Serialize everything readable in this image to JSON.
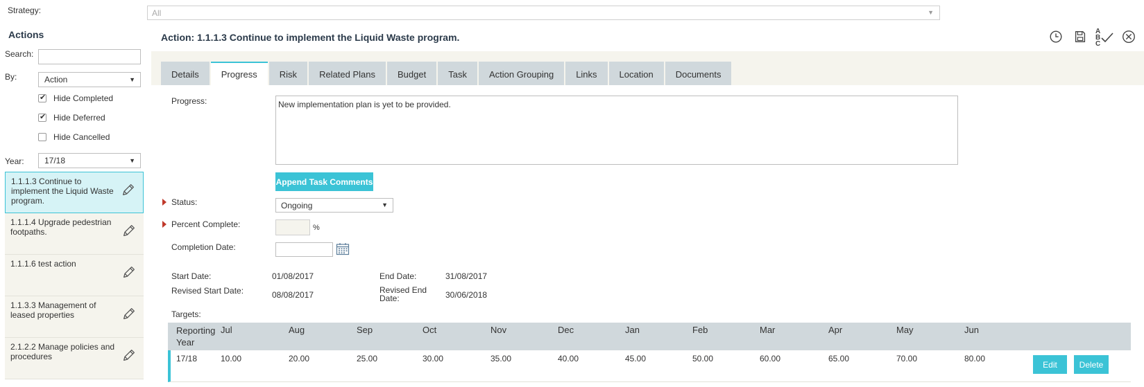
{
  "strategy": {
    "label": "Strategy:",
    "value": "All"
  },
  "sidebar": {
    "title": "Actions",
    "search_label": "Search:",
    "by_label": "By:",
    "by_value": "Action",
    "checkboxes": [
      {
        "label": "Hide Completed",
        "checked": true
      },
      {
        "label": "Hide Deferred",
        "checked": true
      },
      {
        "label": "Hide Cancelled",
        "checked": false
      }
    ],
    "year_label": "Year:",
    "year_value": "17/18",
    "items": [
      {
        "label": "1.1.1.3 Continue to implement the Liquid Waste program."
      },
      {
        "label": "1.1.1.4 Upgrade pedestrian footpaths."
      },
      {
        "label": "1.1.1.6 test action"
      },
      {
        "label": "1.1.3.3 Management of leased properties"
      },
      {
        "label": "2.1.2.2 Manage policies and procedures"
      }
    ]
  },
  "header": {
    "title": "Action: 1.1.1.3 Continue to implement the Liquid Waste program.",
    "icons": [
      "history-icon",
      "save-icon",
      "spellcheck-icon",
      "close-icon"
    ],
    "spellcheck_text": "ABC"
  },
  "tabs": [
    {
      "label": "Details"
    },
    {
      "label": "Progress"
    },
    {
      "label": "Risk"
    },
    {
      "label": "Related Plans"
    },
    {
      "label": "Budget"
    },
    {
      "label": "Task"
    },
    {
      "label": "Action Grouping"
    },
    {
      "label": "Links"
    },
    {
      "label": "Location"
    },
    {
      "label": "Documents"
    }
  ],
  "progress": {
    "label": "Progress:",
    "text": "New implementation plan is yet to be provided.",
    "append_button": "Append Task Comments",
    "status_label": "Status:",
    "status_value": "Ongoing",
    "percent_label": "Percent Complete:",
    "percent_value": "",
    "percent_unit": "%",
    "completion_label": "Completion Date:",
    "completion_value": "",
    "start_label": "Start Date:",
    "start_value": "01/08/2017",
    "end_label": "End Date:",
    "end_value": "31/08/2017",
    "revised_start_label": "Revised Start Date:",
    "revised_start_value": "08/08/2017",
    "revised_end_label": "Revised End Date:",
    "revised_end_value": "30/06/2018"
  },
  "targets": {
    "label": "Targets:",
    "columns": [
      "Reporting Year",
      "Jul",
      "Aug",
      "Sep",
      "Oct",
      "Nov",
      "Dec",
      "Jan",
      "Feb",
      "Mar",
      "Apr",
      "May",
      "Jun"
    ],
    "rows": [
      {
        "year": "17/18",
        "values": [
          "10.00",
          "20.00",
          "25.00",
          "30.00",
          "35.00",
          "40.00",
          "45.00",
          "50.00",
          "60.00",
          "65.00",
          "70.00",
          "80.00"
        ]
      }
    ],
    "edit_label": "Edit",
    "delete_label": "Delete"
  },
  "colors": {
    "accent": "#3bc3d6",
    "tab_bg": "#d0d8dc",
    "panel_bg": "#f5f4ed",
    "required": "#c0392b"
  }
}
